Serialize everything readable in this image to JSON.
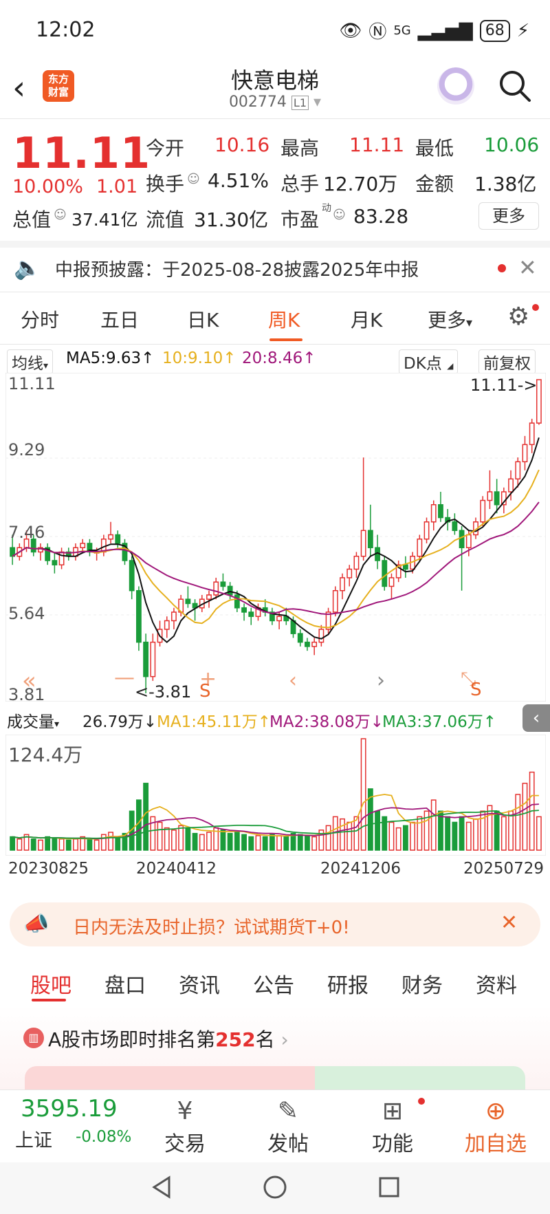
{
  "status_bar": {
    "time": "12:02",
    "network": "5G",
    "battery": "68"
  },
  "header": {
    "stock_name": "快意电梯",
    "stock_code": "002774",
    "market_tag": "L1",
    "logo_text_1": "东方",
    "logo_text_2": "财富"
  },
  "quote": {
    "price": "11.11",
    "change_pct": "10.00%",
    "change": "1.01",
    "open_label": "今开",
    "open": "10.16",
    "high_label": "最高",
    "high": "11.11",
    "low_label": "最低",
    "low": "10.06",
    "turnover_label": "换手",
    "turnover": "4.51%",
    "volume_label": "总手",
    "volume": "12.70万",
    "amount_label": "金额",
    "amount": "1.38亿",
    "mktcap_label": "总值",
    "mktcap": "37.41亿",
    "float_label": "流值",
    "float": "31.30亿",
    "pe_label": "市盈",
    "pe_sup": "动",
    "pe": "83.28",
    "more": "更多"
  },
  "notice": {
    "text": "中报预披露：于2025-08-28披露2025年中报"
  },
  "chart_tabs": [
    "分时",
    "五日",
    "日K",
    "周K",
    "月K",
    "更多"
  ],
  "ma_bar": {
    "selector": "均线",
    "ma5": "MA5:9.63↑",
    "ma10": "10:9.10↑",
    "ma20": "20:8.46↑",
    "dk": "DK点",
    "adjust": "前复权"
  },
  "vol_bar": {
    "selector": "成交量",
    "vol": "26.79万↓",
    "ma1": "MA1:45.11万↑",
    "ma2": "MA2:38.08万↓",
    "ma3": "MA3:37.06万↑"
  },
  "colors": {
    "up": "#e4302f",
    "down": "#1a9c3a",
    "accent": "#f05a24",
    "ma5": "#111111",
    "ma10": "#e6b01e",
    "ma20": "#a0177a"
  },
  "chart_data": {
    "type": "candlestick",
    "y_ticks": [
      "11.11",
      "9.29",
      "7.46",
      "5.64",
      "3.81"
    ],
    "ylim": [
      3.81,
      11.11
    ],
    "max_label": "11.11->",
    "min_label": "<-3.81",
    "x_labels": [
      "20230825",
      "20240412",
      "20241206",
      "20250729"
    ],
    "volume_max_label": "124.4万",
    "ohlc": [
      [
        7.2,
        7.5,
        6.8,
        7.0
      ],
      [
        7.0,
        7.3,
        6.9,
        7.2
      ],
      [
        7.2,
        7.6,
        7.1,
        7.4
      ],
      [
        7.4,
        7.5,
        7.0,
        7.1
      ],
      [
        7.1,
        7.3,
        6.9,
        7.2
      ],
      [
        7.2,
        7.3,
        6.8,
        6.9
      ],
      [
        6.9,
        7.1,
        6.6,
        6.8
      ],
      [
        6.8,
        7.2,
        6.7,
        7.1
      ],
      [
        7.1,
        7.2,
        6.9,
        7.0
      ],
      [
        7.0,
        7.3,
        6.9,
        7.2
      ],
      [
        7.2,
        7.4,
        7.1,
        7.3
      ],
      [
        7.3,
        7.4,
        7.0,
        7.1
      ],
      [
        7.1,
        7.2,
        6.9,
        7.1
      ],
      [
        7.1,
        7.5,
        7.0,
        7.4
      ],
      [
        7.4,
        7.8,
        7.3,
        7.5
      ],
      [
        7.5,
        7.6,
        7.2,
        7.3
      ],
      [
        7.3,
        7.4,
        6.8,
        6.9
      ],
      [
        6.9,
        7.0,
        6.0,
        6.2
      ],
      [
        6.2,
        6.3,
        4.8,
        5.0
      ],
      [
        5.0,
        5.2,
        3.81,
        4.2
      ],
      [
        4.2,
        5.2,
        4.1,
        5.0
      ],
      [
        5.0,
        5.5,
        4.9,
        5.3
      ],
      [
        5.3,
        5.6,
        5.1,
        5.5
      ],
      [
        5.5,
        5.8,
        5.3,
        5.7
      ],
      [
        5.7,
        6.1,
        5.6,
        6.0
      ],
      [
        6.0,
        6.3,
        5.8,
        5.9
      ],
      [
        5.9,
        6.0,
        5.5,
        5.8
      ],
      [
        5.8,
        6.1,
        5.7,
        6.0
      ],
      [
        6.0,
        6.2,
        5.8,
        6.1
      ],
      [
        6.1,
        6.5,
        6.0,
        6.4
      ],
      [
        6.4,
        6.6,
        6.2,
        6.3
      ],
      [
        6.3,
        6.4,
        6.0,
        6.1
      ],
      [
        6.1,
        6.2,
        5.7,
        5.8
      ],
      [
        5.8,
        5.9,
        5.5,
        5.7
      ],
      [
        5.7,
        5.8,
        5.4,
        5.6
      ],
      [
        5.6,
        5.9,
        5.5,
        5.8
      ],
      [
        5.8,
        6.0,
        5.6,
        5.7
      ],
      [
        5.7,
        5.8,
        5.4,
        5.5
      ],
      [
        5.5,
        5.7,
        5.3,
        5.6
      ],
      [
        5.6,
        5.8,
        5.4,
        5.5
      ],
      [
        5.5,
        5.6,
        5.1,
        5.2
      ],
      [
        5.2,
        5.3,
        4.9,
        5.0
      ],
      [
        5.0,
        5.1,
        4.8,
        4.9
      ],
      [
        4.9,
        5.1,
        4.7,
        5.0
      ],
      [
        5.0,
        5.4,
        4.9,
        5.3
      ],
      [
        5.3,
        5.8,
        5.2,
        5.7
      ],
      [
        5.7,
        6.3,
        5.6,
        6.2
      ],
      [
        6.2,
        6.6,
        6.0,
        6.5
      ],
      [
        6.5,
        6.8,
        6.3,
        6.7
      ],
      [
        6.7,
        7.1,
        6.5,
        7.0
      ],
      [
        7.0,
        9.3,
        6.9,
        7.6
      ],
      [
        7.6,
        8.2,
        7.0,
        7.2
      ],
      [
        7.2,
        7.5,
        6.7,
        6.9
      ],
      [
        6.9,
        7.0,
        6.2,
        6.3
      ],
      [
        6.3,
        6.6,
        6.0,
        6.5
      ],
      [
        6.5,
        6.9,
        6.4,
        6.8
      ],
      [
        6.8,
        7.0,
        6.5,
        6.7
      ],
      [
        6.7,
        7.1,
        6.6,
        7.0
      ],
      [
        7.0,
        7.5,
        6.9,
        7.4
      ],
      [
        7.4,
        7.9,
        7.3,
        7.8
      ],
      [
        7.8,
        8.3,
        7.6,
        8.2
      ],
      [
        8.2,
        8.5,
        7.8,
        7.9
      ],
      [
        7.9,
        8.1,
        7.6,
        7.8
      ],
      [
        7.8,
        8.0,
        7.5,
        7.6
      ],
      [
        7.6,
        7.7,
        6.2,
        7.2
      ],
      [
        7.2,
        7.6,
        7.0,
        7.5
      ],
      [
        7.5,
        7.9,
        7.4,
        7.8
      ],
      [
        7.8,
        8.4,
        7.7,
        8.3
      ],
      [
        8.3,
        9.0,
        8.1,
        8.5
      ],
      [
        8.5,
        8.8,
        8.0,
        8.2
      ],
      [
        8.2,
        8.6,
        8.0,
        8.5
      ],
      [
        8.5,
        9.0,
        8.3,
        8.8
      ],
      [
        8.8,
        9.3,
        8.6,
        9.2
      ],
      [
        9.2,
        9.8,
        9.0,
        9.6
      ],
      [
        9.6,
        10.2,
        9.4,
        10.1
      ],
      [
        10.1,
        11.11,
        10.06,
        11.11
      ]
    ],
    "volume_relative": [
      0.12,
      0.1,
      0.14,
      0.1,
      0.09,
      0.12,
      0.11,
      0.1,
      0.09,
      0.1,
      0.12,
      0.1,
      0.09,
      0.14,
      0.16,
      0.12,
      0.15,
      0.35,
      0.45,
      0.6,
      0.3,
      0.25,
      0.2,
      0.18,
      0.22,
      0.2,
      0.15,
      0.14,
      0.16,
      0.2,
      0.18,
      0.15,
      0.16,
      0.14,
      0.12,
      0.13,
      0.12,
      0.14,
      0.13,
      0.12,
      0.15,
      0.14,
      0.13,
      0.12,
      0.18,
      0.22,
      0.3,
      0.28,
      0.25,
      0.3,
      1.0,
      0.55,
      0.35,
      0.3,
      0.25,
      0.2,
      0.22,
      0.25,
      0.3,
      0.35,
      0.45,
      0.35,
      0.3,
      0.25,
      0.3,
      0.25,
      0.28,
      0.35,
      0.4,
      0.35,
      0.3,
      0.35,
      0.5,
      0.6,
      0.7,
      0.3
    ]
  },
  "promo": {
    "text": "日内无法及时止损？试试期货T+0!"
  },
  "lower_tabs": [
    "股吧",
    "盘口",
    "资讯",
    "公告",
    "研报",
    "财务",
    "资料"
  ],
  "rank": {
    "prefix": "A股市场即时排名第",
    "number": "252",
    "suffix": "名"
  },
  "bottom_bar": {
    "index_value": "3595.19",
    "index_name": "上证",
    "index_change": "-0.08%",
    "trade": "交易",
    "post": "发帖",
    "function": "功能",
    "add_watch": "加自选"
  }
}
